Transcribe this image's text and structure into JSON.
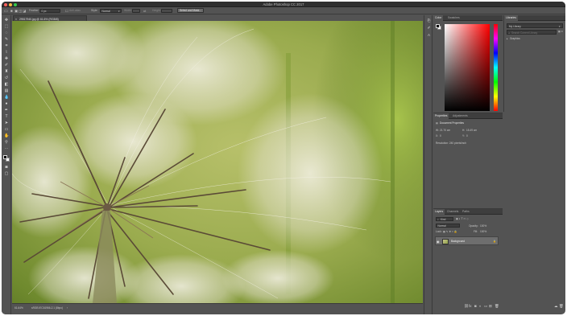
{
  "app": {
    "title": "Adobe Photoshop CC 2017"
  },
  "options_bar": {
    "feather_label": "Feather:",
    "feather_value": "0 px",
    "antialias_label": "Anti-alias",
    "style_label": "Style:",
    "style_value": "Normal",
    "width_label": "Width:",
    "height_label": "Height:",
    "select_mask_button": "Select and Mask..."
  },
  "document": {
    "tab_label": "29517940.jpg @ 61.6% (RGB/8)",
    "zoom": "61.64%",
    "doc_info": "sRGB IEC61966-2.1 (8bpc)"
  },
  "color_panel": {
    "tabs": [
      "Color",
      "Swatches"
    ],
    "accent_hue": "#ff0000"
  },
  "libraries_panel": {
    "tab": "Libraries",
    "library_select": "My Library",
    "search_placeholder": "Search Current Library",
    "section": "Graphics"
  },
  "properties_panel": {
    "tabs": [
      "Properties",
      "Adjustments"
    ],
    "heading": "Document Properties",
    "w_label": "W:",
    "w_value": "21.70 cm",
    "h_label": "H:",
    "h_value": "15.49 cm",
    "x_label": "X:",
    "x_value": "0",
    "y_label": "Y:",
    "y_value": "0",
    "resolution": "Resolution: 240 pixels/inch"
  },
  "layers_panel": {
    "tabs": [
      "Layers",
      "Channels",
      "Paths"
    ],
    "kind_label": "Kind",
    "blend_mode": "Normal",
    "opacity_label": "Opacity:",
    "opacity_value": "100%",
    "lock_label": "Lock:",
    "fill_label": "Fill:",
    "fill_value": "100%",
    "layer_name": "Background"
  }
}
